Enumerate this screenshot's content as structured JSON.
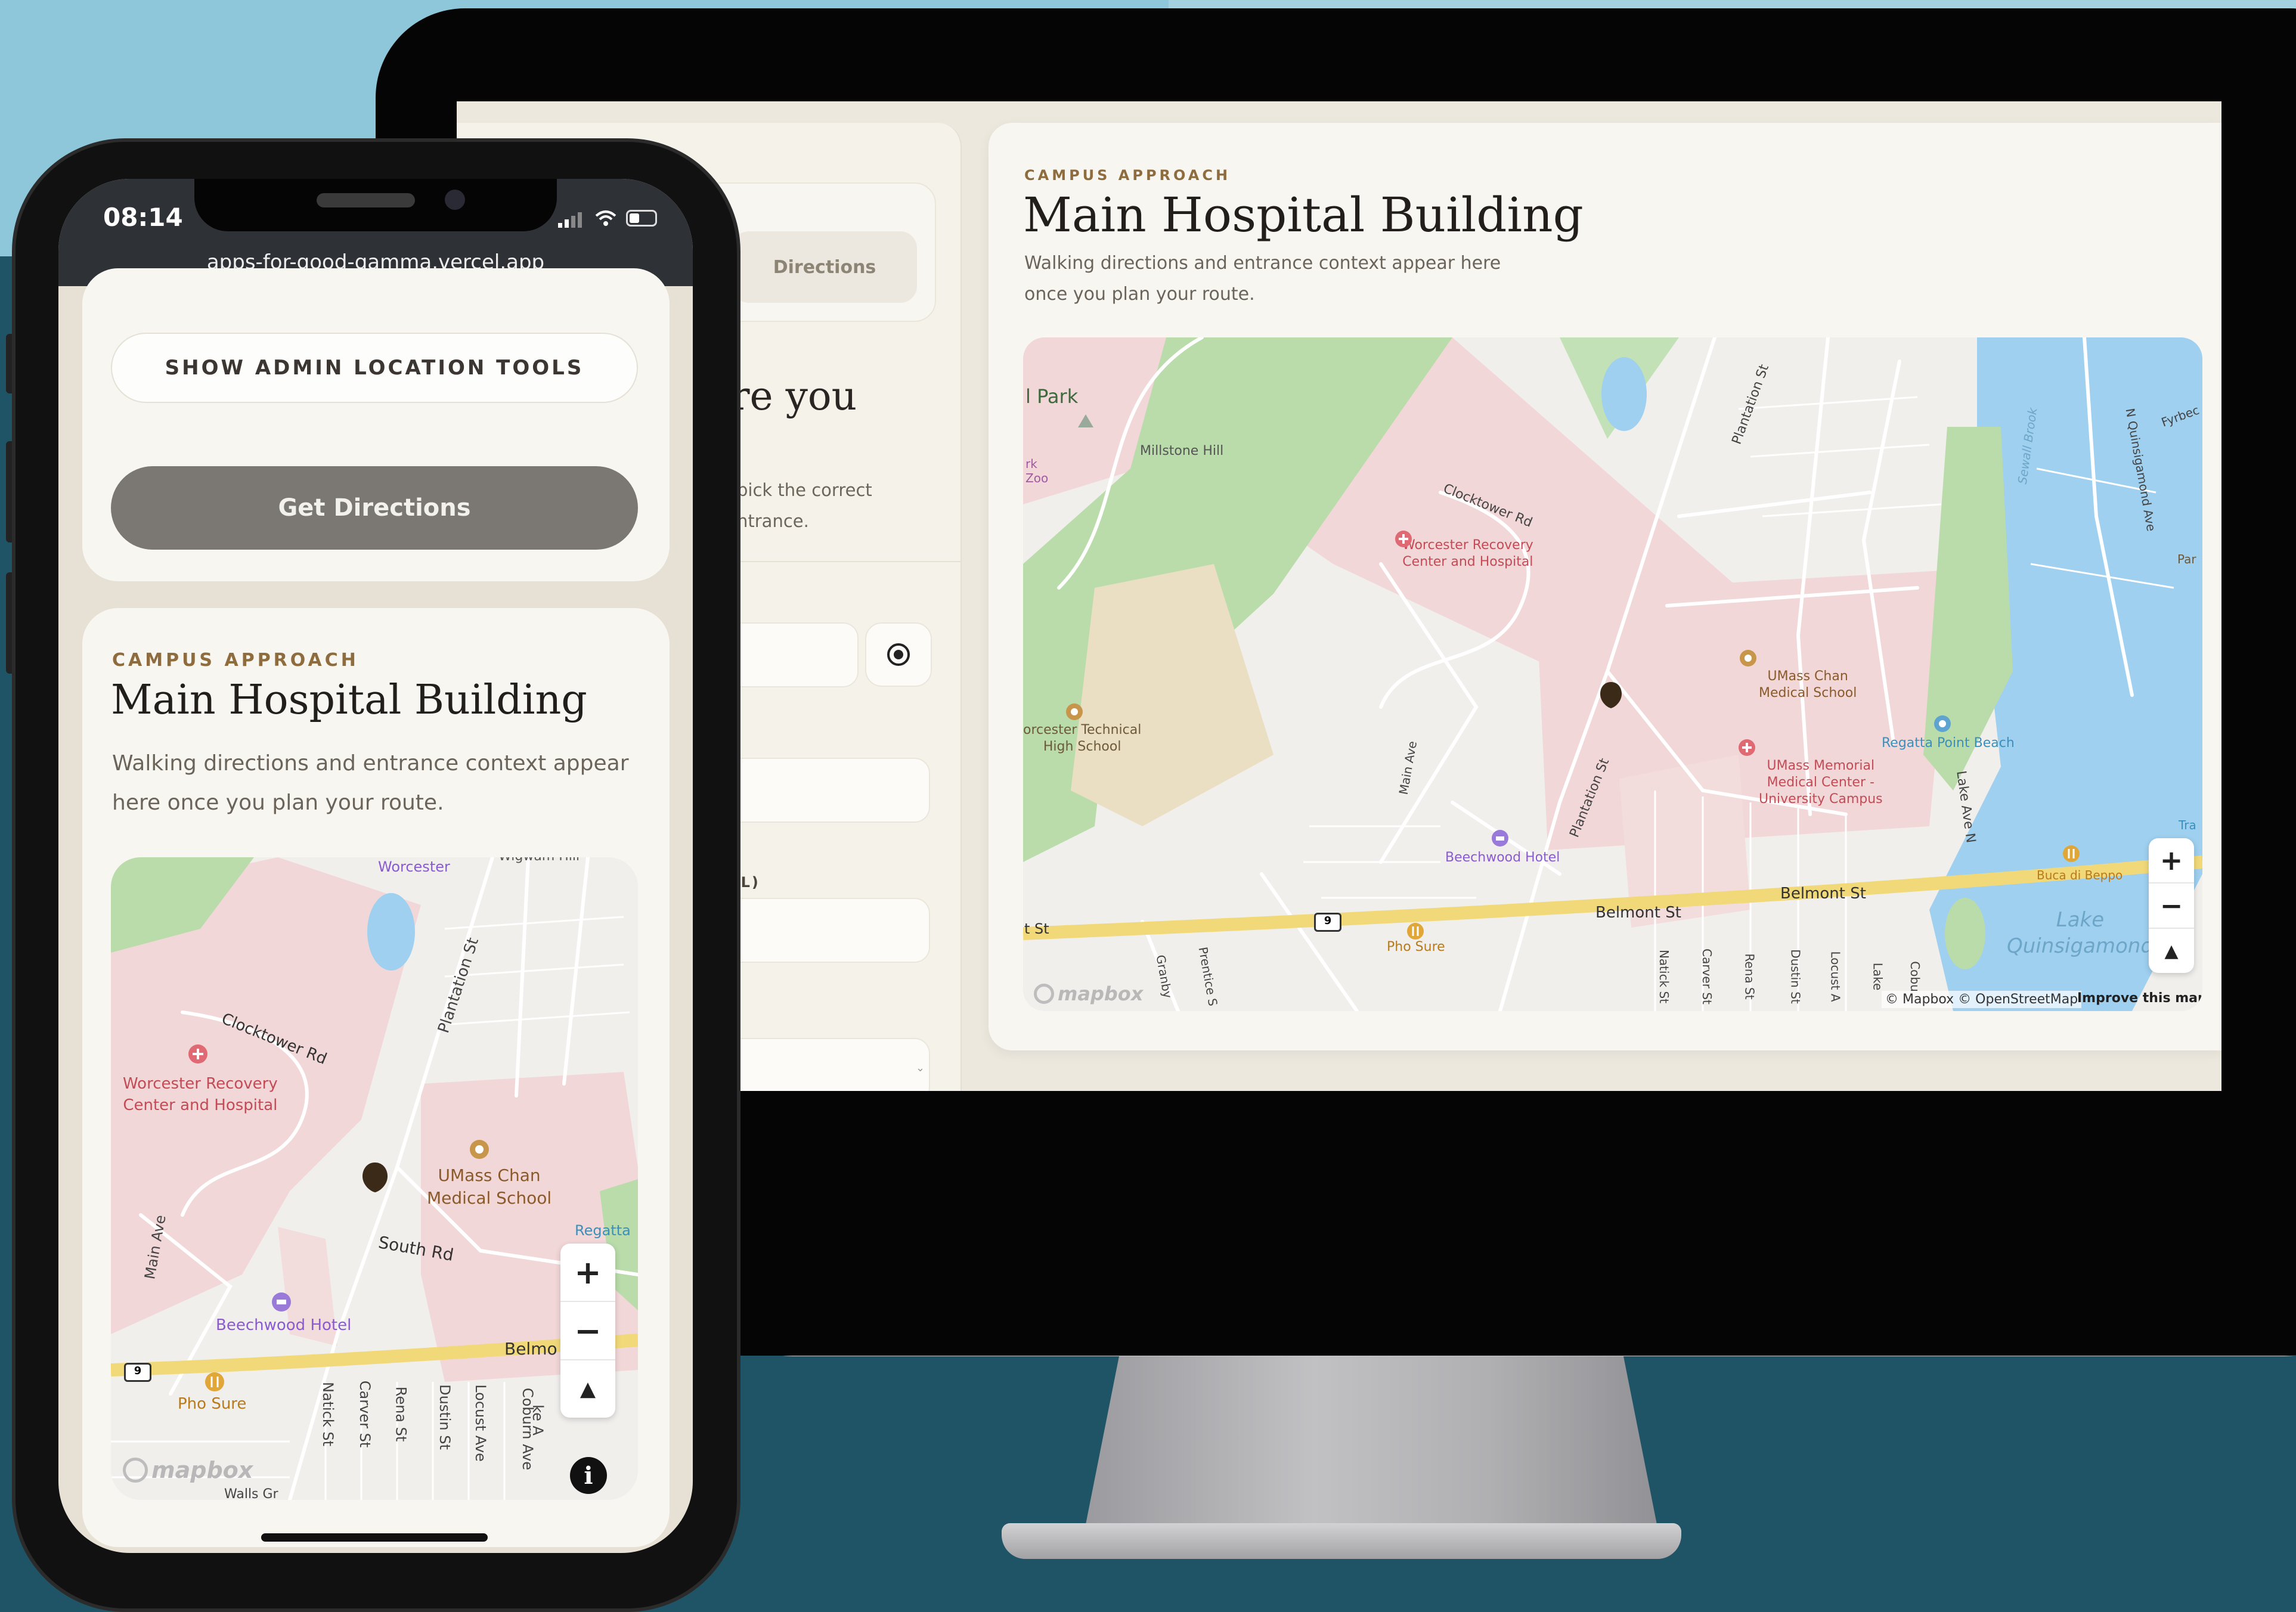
{
  "desktop": {
    "left_panel": {
      "tab_label": "Directions",
      "heading_fragment": "re you",
      "body_fragment": "pick the correct\nntrance.",
      "field_label_fragment": "AL)"
    },
    "card": {
      "eyebrow": "CAMPUS APPROACH",
      "title": "Main Hospital Building",
      "description_line1": "Walking directions and entrance context appear here",
      "description_line2": "once you plan your route."
    },
    "map": {
      "labels": {
        "park": "l Park",
        "zoo": "rk\nZoo",
        "millstone": "Millstone Hill",
        "clocktower": "Clocktower Rd",
        "worcester_recovery": "Worcester Recovery\nCenter and Hospital",
        "plantation_top": "Plantation St",
        "umass_chan": "UMass Chan\nMedical School",
        "umass_memorial": "UMass Memorial\nMedical Center -\nUniversity Campus",
        "technical": "orcester Technical\nHigh School",
        "main_ave": "Main Ave",
        "plantation_bottom": "Plantation St",
        "beechwood": "Beechwood Hotel",
        "belmont1": "Belmont St",
        "belmont2": "Belmont St",
        "st_left": "t St",
        "pho_sure": "Pho Sure",
        "regatta": "Regatta Point Beach",
        "lake_ave": "Lake Ave N",
        "sewall": "Sewall Brook",
        "quinsigamond_ave": "N Quinsigamond Ave",
        "fyrbec": "Fyrbec",
        "par": "Par",
        "tra": "Tra",
        "buca": "Buca di Beppo",
        "lake": "Lake\nQuinsigamond",
        "route": "9",
        "streets": [
          "Granby",
          "Prentice S",
          "Natick St",
          "Carver St",
          "Rena St",
          "Dustin St",
          "Locust A",
          "Lake",
          "Cobu"
        ]
      },
      "attribution": "© Mapbox © OpenStreetMap",
      "improve": "Improve this map",
      "logo": "mapbox"
    }
  },
  "phone": {
    "status_time": "08:14",
    "url": "apps-for-good-gamma.vercel.app",
    "admin_button": "SHOW ADMIN LOCATION TOOLS",
    "directions_button": "Get Directions",
    "card": {
      "eyebrow": "CAMPUS APPROACH",
      "title": "Main Hospital Building",
      "description_line1": "Walking directions and entrance context appear",
      "description_line2": "here once you plan your route."
    },
    "map": {
      "labels": {
        "worcester": "Worcester",
        "wigwam": "Wigwam Hill",
        "plantation": "Plantation St",
        "clocktower": "Clocktower Rd",
        "worcester_recovery": "Worcester Recovery\nCenter and Hospital",
        "umass_chan": "UMass Chan\nMedical School",
        "main_ave": "Main Ave",
        "south_rd": "South Rd",
        "regatta": "Regatta",
        "beechwood": "Beechwood Hotel",
        "belmo": "Belmo",
        "pho_sure": "Pho Sure",
        "route": "9",
        "streets": [
          "Natick St",
          "Carver St",
          "Rena St",
          "Dustin St",
          "Locust Ave",
          "Coburn Ave",
          "ke A"
        ],
        "walls": "Walls Gr"
      },
      "logo": "mapbox"
    }
  },
  "colors": {
    "accent_gold": "#8f6c3d",
    "map_pink": "#f2d7d8",
    "map_green": "#b9dcaa",
    "map_water": "#9fd0f0",
    "highway": "#f1d97a"
  }
}
